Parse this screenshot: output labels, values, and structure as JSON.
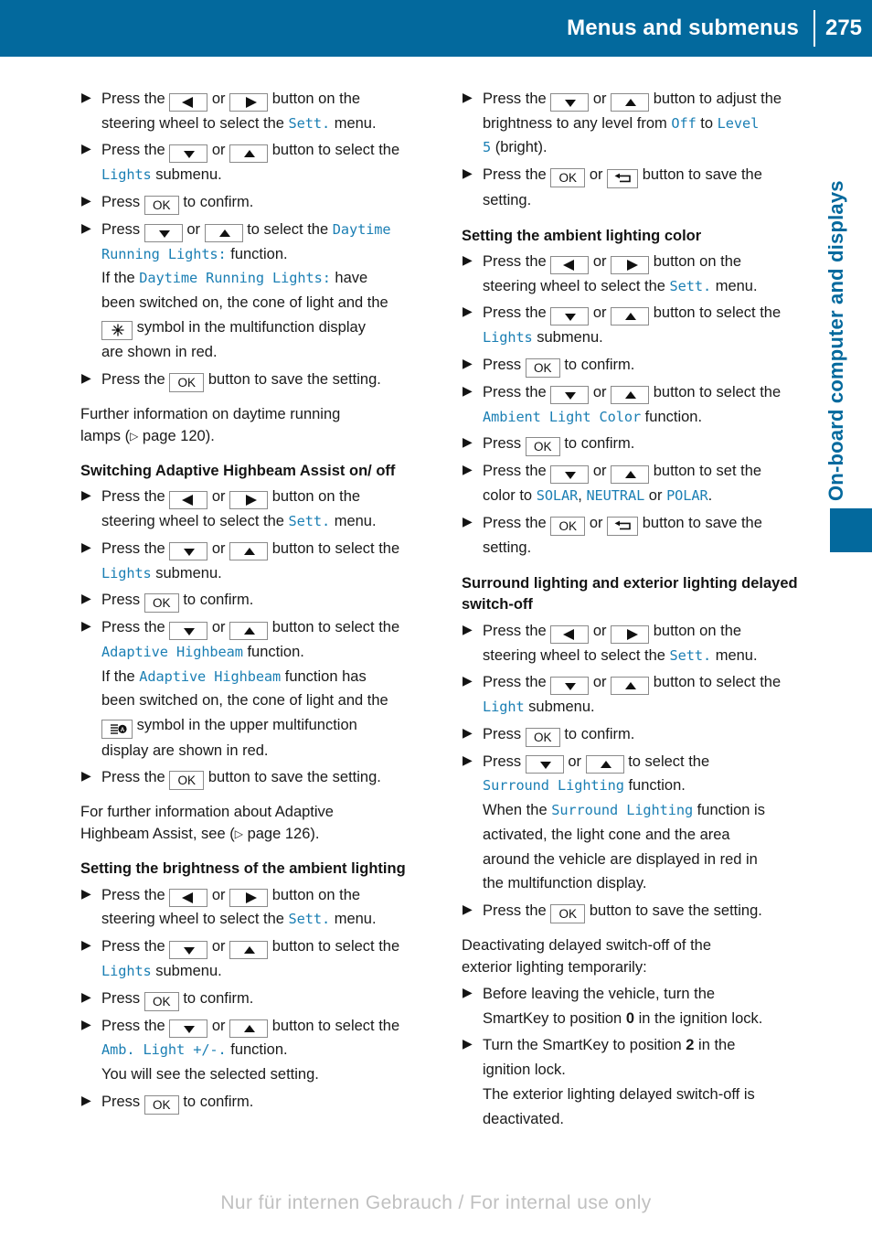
{
  "header": {
    "title": "Menus and submenus",
    "page_number": "275"
  },
  "side_tab": {
    "label": "On-board computer and displays",
    "accent_color": "#03699d"
  },
  "colors": {
    "header_blue": "#03699d",
    "mono_blue": "#1b7fb4",
    "key_border": "#8a8a8a",
    "watermark_gray": "#9a9a9a"
  },
  "icons": {
    "left_arrow": "left-triangle-icon",
    "right_arrow": "right-triangle-icon",
    "down_arrow": "down-triangle-icon",
    "up_arrow": "up-triangle-icon",
    "ok": "OK",
    "back": "back-arrow-icon",
    "daytime_running_lights": "sun-starburst-icon",
    "adaptive_highbeam": "highbeam-assist-icon",
    "page_ref": "page-reference-triangle-icon"
  },
  "left_column": {
    "steps_daytime": [
      {
        "text_before": "Press the ",
        "key1": "left-arrow",
        "or": " or ",
        "key2": "right-arrow",
        "text_after": " button on the",
        "sub": "steering wheel to select the ",
        "mono": "Sett.",
        "sub_after": " menu."
      },
      {
        "text_before": "Press the ",
        "key1": "down-arrow",
        "or": " or ",
        "key2": "up-arrow",
        "text_after": " button to select the",
        "sub_mono": "Lights",
        "sub_after": " submenu."
      },
      {
        "text_before": "Press ",
        "key1": "ok",
        "text_after": " to confirm."
      },
      {
        "text_before": "Press ",
        "key1": "down-arrow",
        "or": " or ",
        "key2": "up-arrow",
        "text_after": " to select the ",
        "mono_tail": "Daytime",
        "line2_mono": "Running Lights:",
        "line2_after": " function.",
        "line3_before": "If the ",
        "line3_mono": "Daytime Running Lights:",
        "line3_after": " have",
        "line4": "been switched on, the cone of light and the",
        "line5_after": " symbol in the multifunction display",
        "line6": "are shown in red."
      },
      {
        "text_before": "Press the ",
        "key1": "ok",
        "text_after": " button to save the setting."
      }
    ],
    "para_daytime": {
      "line1": "Further information on daytime running",
      "line2_before": "lamps (",
      "line2_page": " page 120)."
    },
    "heading_highbeam": "Switching Adaptive Highbeam Assist on/ off",
    "steps_highbeam": [
      {
        "text_before": "Press the ",
        "or": " or ",
        "text_after": " button on the",
        "sub": "steering wheel to select the ",
        "mono": "Sett.",
        "sub_after": " menu."
      },
      {
        "text_before": "Press the ",
        "or": " or ",
        "text_after": " button to select the",
        "sub_mono": "Lights",
        "sub_after": " submenu."
      },
      {
        "text_before": "Press ",
        "text_after": " to confirm."
      },
      {
        "text_before": "Press the ",
        "or": " or ",
        "text_after": " button to select the",
        "line2_mono": "Adaptive Highbeam",
        "line2_after": " function.",
        "line3_before": "If the ",
        "line3_mono": "Adaptive Highbeam",
        "line3_after": " function has",
        "line4": "been switched on, the cone of light and the",
        "line5_after": " symbol in the upper multifunction",
        "line6": "display are shown in red."
      },
      {
        "text_before": "Press the ",
        "text_after": " button to save the setting."
      }
    ],
    "para_highbeam": {
      "line1": "For further information about Adaptive",
      "line2_before": "Highbeam Assist, see (",
      "line2_page": " page 126)."
    },
    "heading_brightness": "Setting the brightness of the ambient lighting",
    "steps_brightness": [
      {
        "text_before": "Press the ",
        "or": " or ",
        "text_after": " button on the",
        "sub": "steering wheel to select the ",
        "mono": "Sett.",
        "sub_after": " menu."
      },
      {
        "text_before": "Press the ",
        "or": " or ",
        "text_after": " button to select the",
        "sub_mono": "Lights",
        "sub_after": " submenu."
      },
      {
        "text_before": "Press ",
        "text_after": " to confirm."
      },
      {
        "text_before": "Press the ",
        "or": " or ",
        "text_after": " button to select the",
        "line2_mono": "Amb. Light +/-.",
        "line2_after": " function.",
        "line3": "You will see the selected setting."
      },
      {
        "text_before": "Press ",
        "text_after": " to confirm."
      }
    ]
  },
  "right_column": {
    "steps_brightness_cont": [
      {
        "text_before": "Press the ",
        "or": " or ",
        "text_after": " button to adjust the",
        "line2_before": "brightness to any level from ",
        "line2_mono1": "Off",
        "line2_mid": " to ",
        "line2_mono2": "Level",
        "line3_mono": "5",
        "line3_after": " (bright)."
      },
      {
        "text_before": "Press the ",
        "or": " or ",
        "text_after": " button to save the",
        "line2": "setting."
      }
    ],
    "heading_color": "Setting the ambient lighting color",
    "steps_color": [
      {
        "text_before": "Press the ",
        "or": " or ",
        "text_after": " button on the",
        "sub": "steering wheel to select the ",
        "mono": "Sett.",
        "sub_after": " menu."
      },
      {
        "text_before": "Press the ",
        "or": " or ",
        "text_after": " button to select the",
        "sub_mono": "Lights",
        "sub_after": " submenu."
      },
      {
        "text_before": "Press ",
        "text_after": " to confirm."
      },
      {
        "text_before": "Press the ",
        "or": " or ",
        "text_after": " button to select the",
        "line2_mono": "Ambient Light Color",
        "line2_after": " function."
      },
      {
        "text_before": "Press ",
        "text_after": " to confirm."
      },
      {
        "text_before": "Press the ",
        "or": " or ",
        "text_after": " button to set the",
        "line2_before": "color to ",
        "line2_mono1": "SOLAR",
        "line2_sep1": ", ",
        "line2_mono2": "NEUTRAL",
        "line2_sep2": " or ",
        "line2_mono3": "POLAR",
        "line2_end": "."
      },
      {
        "text_before": "Press the ",
        "or": " or ",
        "text_after": " button to save the",
        "line2": "setting."
      }
    ],
    "heading_surround": "Surround lighting and exterior lighting delayed switch-off",
    "steps_surround": [
      {
        "text_before": "Press the ",
        "or": " or ",
        "text_after": " button on the",
        "sub": "steering wheel to select the ",
        "mono": "Sett.",
        "sub_after": " menu."
      },
      {
        "text_before": "Press the ",
        "or": " or ",
        "text_after": " button to select the",
        "sub_mono": "Light",
        "sub_after": " submenu."
      },
      {
        "text_before": "Press ",
        "text_after": " to confirm."
      },
      {
        "text_before": "Press ",
        "or": " or ",
        "text_after": " to select the",
        "line2_mono": "Surround Lighting",
        "line2_after": " function.",
        "line3_before": "When the ",
        "line3_mono": "Surround Lighting",
        "line3_after": " function is",
        "line4": "activated, the light cone and the area",
        "line5": "around the vehicle are displayed in red in",
        "line6": "the multifunction display."
      },
      {
        "text_before": "Press the ",
        "text_after": " button to save the setting."
      }
    ],
    "para_deactivating": {
      "line1": "Deactivating delayed switch-off of the",
      "line2": "exterior lighting temporarily:"
    },
    "steps_smartkey": [
      {
        "line1": "Before leaving the vehicle, turn the",
        "line2_before": "SmartKey to position ",
        "line2_bold": "0",
        "line2_after": " in the ignition lock."
      },
      {
        "line1_before": "Turn the SmartKey to position ",
        "line1_bold": "2",
        "line1_after": " in the",
        "line2": "ignition lock.",
        "line3": "The exterior lighting delayed switch-off is",
        "line4": "deactivated."
      }
    ]
  },
  "footer": {
    "watermark": "Nur für internen Gebrauch / For internal use only"
  }
}
